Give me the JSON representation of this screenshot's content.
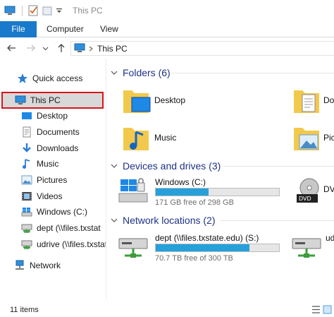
{
  "window": {
    "title": "This PC"
  },
  "ribbon": {
    "tabs": [
      {
        "label": "File"
      },
      {
        "label": "Computer"
      },
      {
        "label": "View"
      }
    ]
  },
  "address_bar": {
    "path": "This PC"
  },
  "nav_pane": {
    "items": [
      {
        "label": "Quick access",
        "icon": "star-icon"
      },
      {
        "label": "This PC",
        "icon": "computer-icon",
        "selected": true
      },
      {
        "label": "Desktop",
        "icon": "desktop-icon"
      },
      {
        "label": "Documents",
        "icon": "documents-icon"
      },
      {
        "label": "Downloads",
        "icon": "download-icon"
      },
      {
        "label": "Music",
        "icon": "music-icon"
      },
      {
        "label": "Pictures",
        "icon": "pictures-icon"
      },
      {
        "label": "Videos",
        "icon": "videos-icon"
      },
      {
        "label": "Windows (C:)",
        "icon": "windows-drive-icon"
      },
      {
        "label": "dept (\\\\files.txstat",
        "icon": "network-drive-icon"
      },
      {
        "label": "udrive (\\\\files.txstat",
        "icon": "network-drive-icon"
      },
      {
        "label": "Network",
        "icon": "network-icon"
      }
    ]
  },
  "groups": {
    "folders": {
      "title": "Folders (6)",
      "items": [
        {
          "label": "Desktop",
          "icon": "desktop-folder-icon"
        },
        {
          "label": "Do",
          "icon": "documents-folder-icon"
        },
        {
          "label": "Music",
          "icon": "music-folder-icon"
        },
        {
          "label": "Pic",
          "icon": "pictures-folder-icon"
        }
      ]
    },
    "devices": {
      "title": "Devices and drives (3)",
      "items": [
        {
          "label": "Windows (C:)",
          "free": "171 GB free of 298 GB",
          "used_fraction": 0.43,
          "icon": "windows-drive-icon"
        },
        {
          "label": "DV",
          "icon": "dvd-drive-icon"
        }
      ]
    },
    "network": {
      "title": "Network locations (2)",
      "items": [
        {
          "label": "dept (\\\\files.txstate.edu) (S:)",
          "free": "70.7 TB free of 300 TB",
          "used_fraction": 0.76,
          "icon": "network-drive-icon"
        },
        {
          "label": "ud",
          "icon": "network-drive-icon"
        }
      ]
    }
  },
  "status_bar": {
    "items_count": "11 items"
  },
  "colors": {
    "accent": "#1979ca",
    "selection_outline": "#d6141c",
    "drive_fill": "#26a0da",
    "group_title": "#1e3287"
  }
}
